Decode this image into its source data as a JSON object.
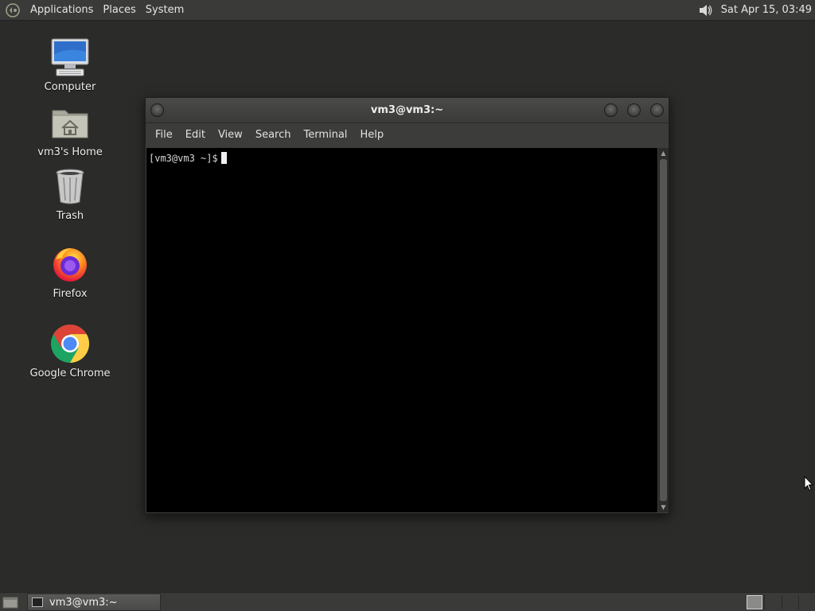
{
  "top_panel": {
    "menus": [
      "Applications",
      "Places",
      "System"
    ],
    "clock": "Sat Apr 15, 03:49",
    "icons": {
      "distro": "distro-logo-icon",
      "volume": "volume-icon"
    }
  },
  "desktop": {
    "icons": [
      {
        "label": "Computer",
        "icon": "computer-icon"
      },
      {
        "label": "vm3's Home",
        "icon": "home-folder-icon"
      },
      {
        "label": "Trash",
        "icon": "trash-icon"
      },
      {
        "label": "Firefox",
        "icon": "firefox-icon"
      },
      {
        "label": "Google Chrome",
        "icon": "chrome-icon"
      }
    ]
  },
  "terminal": {
    "title": "vm3@vm3:~",
    "menu": [
      "File",
      "Edit",
      "View",
      "Search",
      "Terminal",
      "Help"
    ],
    "prompt": "[vm3@vm3 ~]$"
  },
  "bottom_panel": {
    "task_label": "vm3@vm3:~",
    "workspaces": 4,
    "active_workspace": 1
  },
  "colors": {
    "desktop_bg": "#2b2b29",
    "panel_bg": "#3a3a38",
    "terminal_bg": "#000000"
  }
}
